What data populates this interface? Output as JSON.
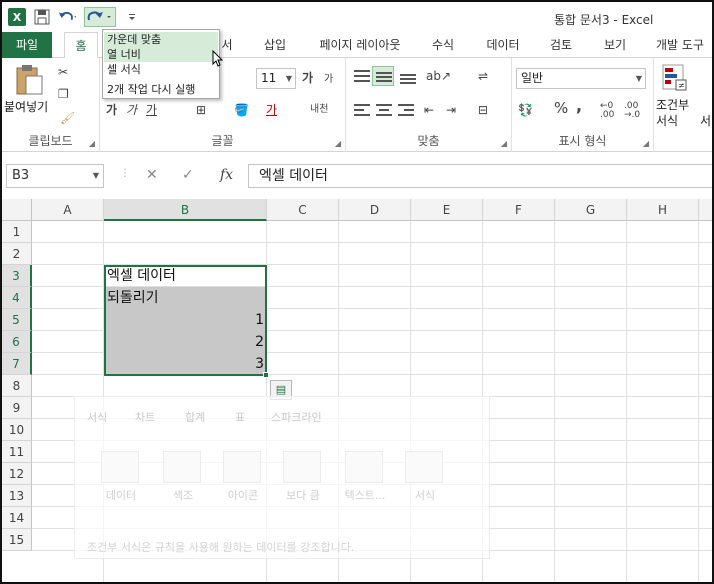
{
  "window": {
    "title": "통합 문서3 - Excel"
  },
  "quick_access": {
    "app_icon": "X",
    "save": "save-icon",
    "undo": "undo-icon",
    "redo": "redo-icon",
    "customize": "customize-icon"
  },
  "tabs": [
    {
      "label": "파일"
    },
    {
      "label": "홈"
    },
    {
      "label": "서"
    },
    {
      "label": "삽입"
    },
    {
      "label": "페이지 레이아웃"
    },
    {
      "label": "수식"
    },
    {
      "label": "데이터"
    },
    {
      "label": "검토"
    },
    {
      "label": "보기"
    },
    {
      "label": "개발 도구"
    }
  ],
  "redo_menu": {
    "items": [
      "가운데 맞춤",
      "열 너비",
      "셀 서식"
    ],
    "footer": "2개 작업 다시 실행"
  },
  "ribbon": {
    "clipboard": {
      "paste_label": "붙여넣기",
      "group": "클립보드"
    },
    "font": {
      "size": "11",
      "group": "글꼴",
      "grow": "가",
      "shrink": "가",
      "bold": "가",
      "italic": "가",
      "underline": "가",
      "phonetic": "내천"
    },
    "alignment": {
      "group": "맞춤"
    },
    "number": {
      "format": "일반",
      "group": "표시 형식",
      "percent": "%",
      "comma": ","
    },
    "styles": {
      "conditional": "조건부",
      "conditional2": "서식",
      "side": "서"
    }
  },
  "formula_bar": {
    "name_box": "B3",
    "fx": "fx",
    "cancel": "✕",
    "confirm": "✓",
    "content": "엑셀 데이터"
  },
  "grid": {
    "columns": [
      "A",
      "B",
      "C",
      "D",
      "E",
      "F",
      "G",
      "H"
    ],
    "rows": [
      "1",
      "2",
      "3",
      "4",
      "5",
      "6",
      "7",
      "8",
      "9",
      "10",
      "11",
      "12",
      "13",
      "14",
      "15"
    ],
    "cells": {
      "B3": "엑셀 데이터",
      "B4": "되돌리기",
      "B5": "1",
      "B6": "2",
      "B7": "3"
    }
  },
  "quick_analysis": {
    "tabs": [
      "서식",
      "차트",
      "합계",
      "표",
      "스파크라인"
    ],
    "options": [
      "데이터",
      "색조",
      "아이콘",
      "보다 큼",
      "텍스트...",
      "서식"
    ],
    "description": "조건부 서식은 규칙을 사용해 원하는 데이터를 강조합니다."
  }
}
